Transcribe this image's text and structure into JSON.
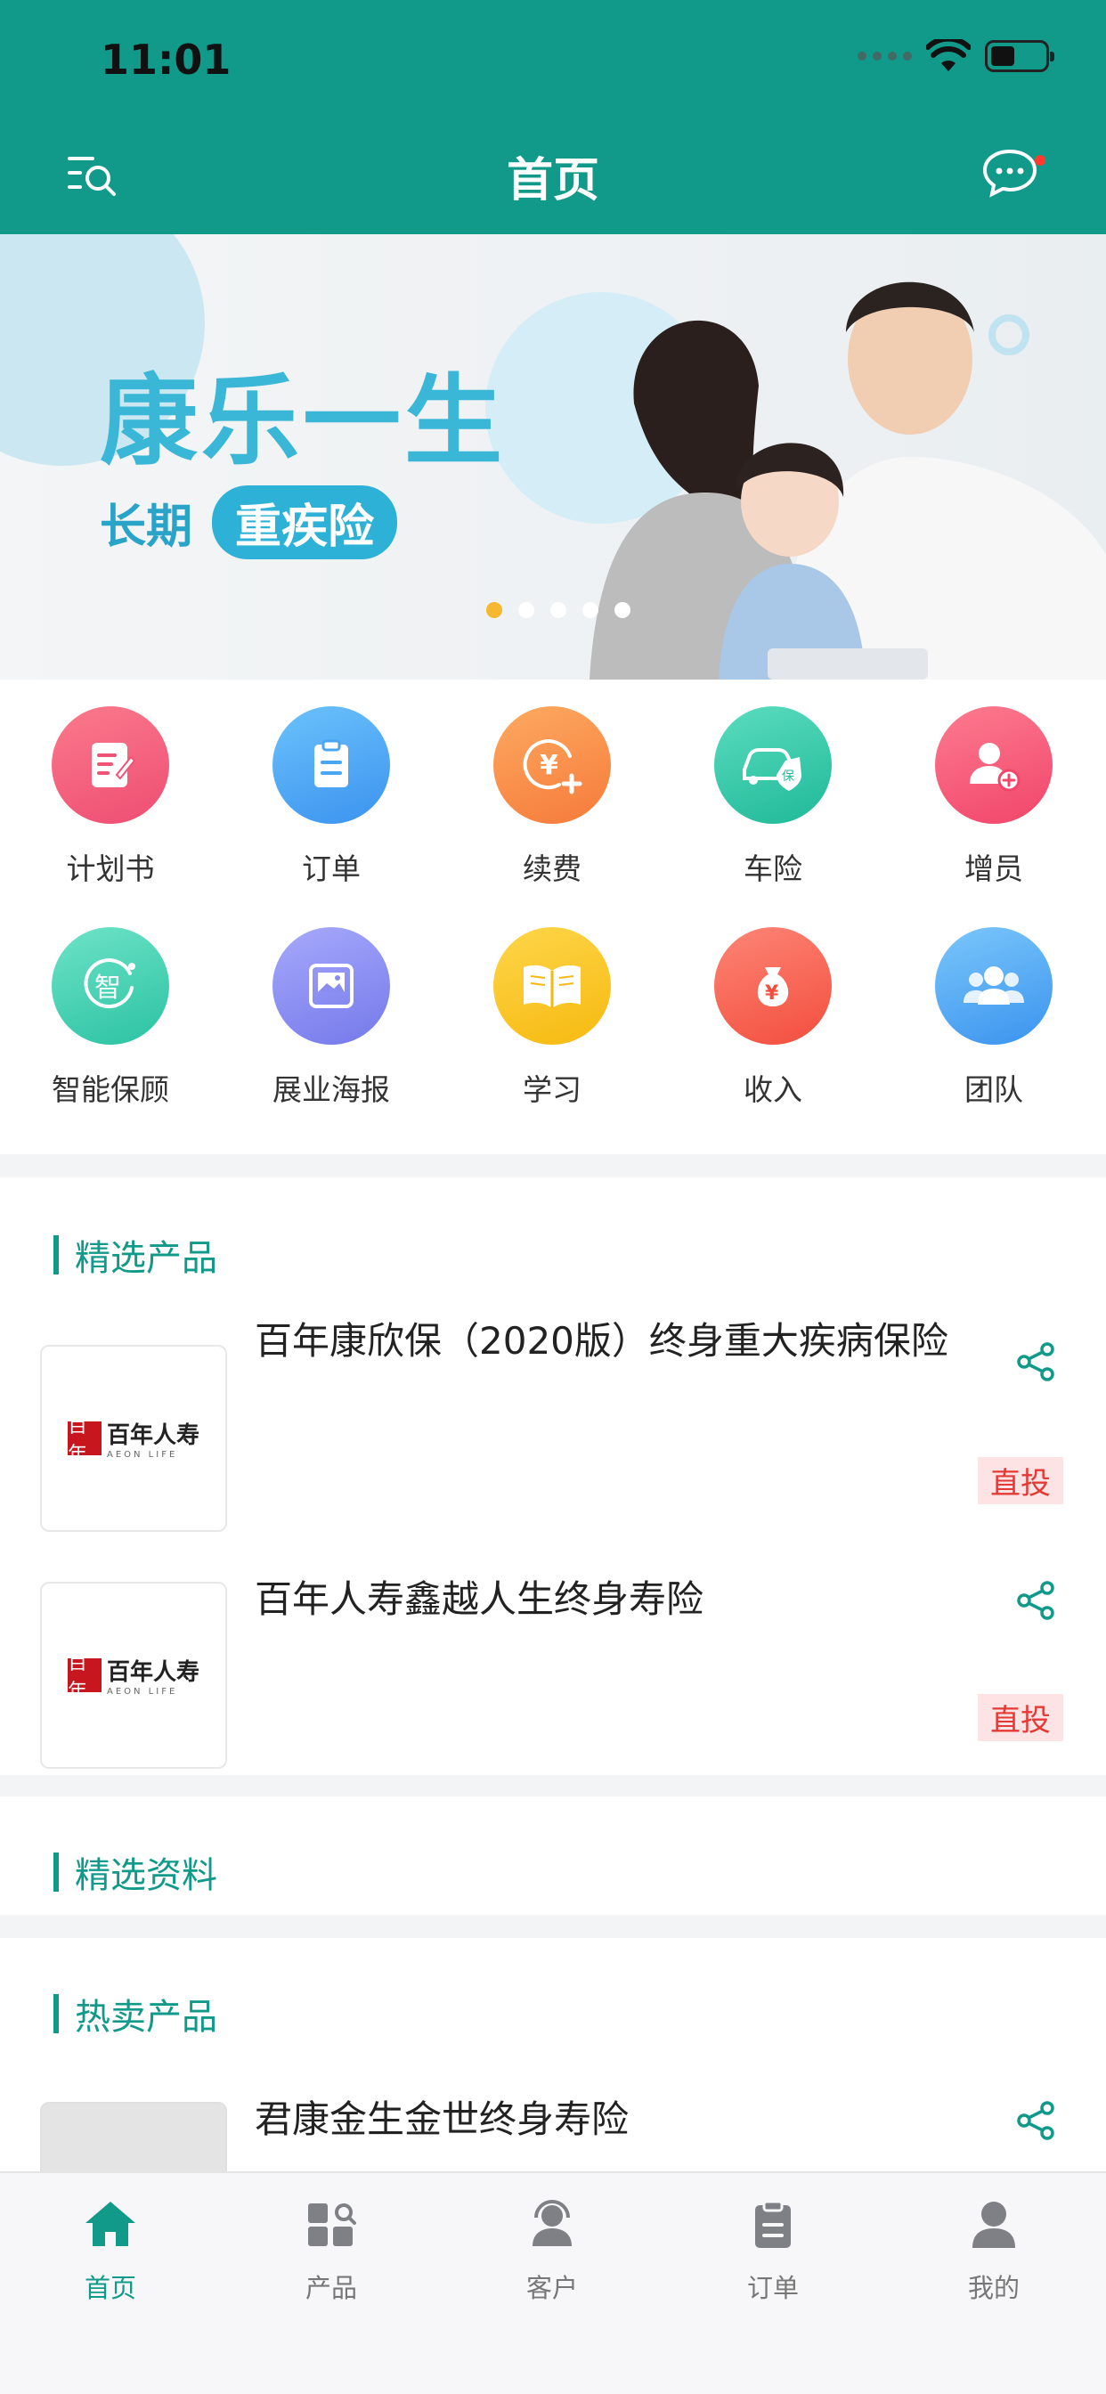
{
  "status_bar": {
    "time": "11:01"
  },
  "header": {
    "title": "首页"
  },
  "banner": {
    "title": "康乐一生",
    "sub_prefix": "长期",
    "sub_pill": "重疾险",
    "dots": 5,
    "active_dot": 0
  },
  "quick_menu": [
    {
      "label": "计划书",
      "icon": "plan-doc-icon",
      "color": "#f0607c"
    },
    {
      "label": "订单",
      "icon": "clipboard-icon",
      "color": "#4aa6f2"
    },
    {
      "label": "续费",
      "icon": "yuan-plus-icon",
      "color": "#f98d4e"
    },
    {
      "label": "车险",
      "icon": "car-shield-icon",
      "color": "#2fc9a8"
    },
    {
      "label": "增员",
      "icon": "add-user-icon",
      "color": "#f5587a"
    },
    {
      "label": "智能保顾",
      "icon": "smart-advisor-icon",
      "color": "#3fd0b0"
    },
    {
      "label": "展业海报",
      "icon": "poster-image-icon",
      "color": "#8a8cf2"
    },
    {
      "label": "学习",
      "icon": "book-icon",
      "color": "#fbc327"
    },
    {
      "label": "收入",
      "icon": "money-bag-icon",
      "color": "#f86756"
    },
    {
      "label": "团队",
      "icon": "team-icon",
      "color": "#45a5f0"
    }
  ],
  "sections": {
    "featured_products": "精选产品",
    "featured_materials": "精选资料",
    "hot_products": "热卖产品"
  },
  "brand": {
    "logo_cn": "百年人寿",
    "logo_en": "AEON LIFE",
    "mark": "百年"
  },
  "featured_products": [
    {
      "name": "百年康欣保（2020版）终身重大疾病保险",
      "tag": "直投"
    },
    {
      "name": "百年人寿鑫越人生终身寿险",
      "tag": "直投"
    }
  ],
  "hot_products": [
    {
      "name": "君康金生金世终身寿险"
    }
  ],
  "tabbar": [
    {
      "label": "首页",
      "icon": "home-icon",
      "active": true
    },
    {
      "label": "产品",
      "icon": "product-grid-icon",
      "active": false
    },
    {
      "label": "客户",
      "icon": "customers-icon",
      "active": false
    },
    {
      "label": "订单",
      "icon": "order-clipboard-icon",
      "active": false
    },
    {
      "label": "我的",
      "icon": "profile-icon",
      "active": false
    }
  ],
  "colors": {
    "primary": "#11998a",
    "tag_bg": "#fde3e3",
    "tag_text": "#e53935",
    "banner_accent": "#3ab6d6"
  }
}
